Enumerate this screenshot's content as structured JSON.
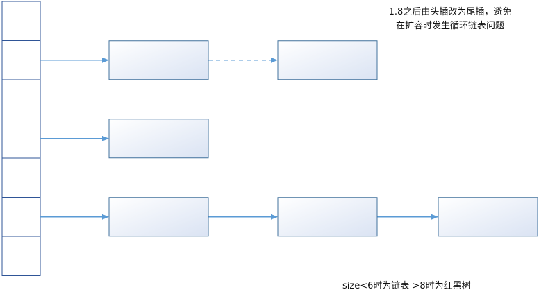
{
  "note": {
    "line1": "1.8之后由头插改为尾插，避免",
    "line2": "在扩容时发生循环链表问题"
  },
  "footer": "size<6时为链表 >8时为红黑树",
  "table": {
    "bucket_count": 7
  },
  "chains": [
    {
      "bucket": 1,
      "nodes": 2,
      "links": [
        "dashed"
      ]
    },
    {
      "bucket": 3,
      "nodes": 1,
      "links": []
    },
    {
      "bucket": 5,
      "nodes": 3,
      "links": [
        "solid",
        "solid"
      ]
    }
  ],
  "colors": {
    "line": "#5b9bd5",
    "border": "#41719c",
    "bucket_border": "#2f5597",
    "node_fill_light": "#ffffff",
    "node_fill_dark": "#dae3f3"
  }
}
